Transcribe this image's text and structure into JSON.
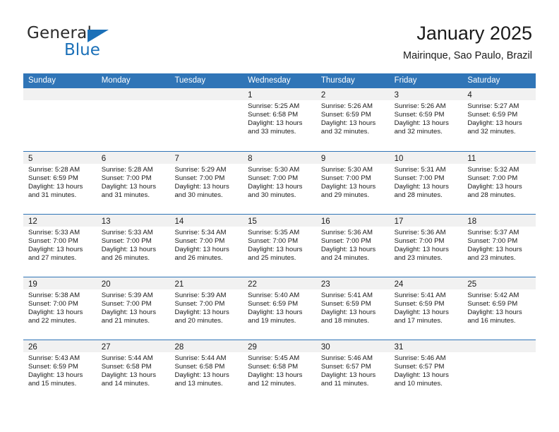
{
  "brand": {
    "name_top": "General",
    "name_bottom": "Blue",
    "accent_color": "#1b70b8"
  },
  "header": {
    "title": "January 2025",
    "subtitle": "Mairinque, Sao Paulo, Brazil",
    "header_bar_color": "#3075b7",
    "day_band_color": "#f1f1f1"
  },
  "weekdays": [
    "Sunday",
    "Monday",
    "Tuesday",
    "Wednesday",
    "Thursday",
    "Friday",
    "Saturday"
  ],
  "weeks": [
    [
      {
        "day": "",
        "sunrise": "",
        "sunset": "",
        "daylight": "",
        "empty": true
      },
      {
        "day": "",
        "sunrise": "",
        "sunset": "",
        "daylight": "",
        "empty": true
      },
      {
        "day": "",
        "sunrise": "",
        "sunset": "",
        "daylight": "",
        "empty": true
      },
      {
        "day": "1",
        "sunrise": "Sunrise: 5:25 AM",
        "sunset": "Sunset: 6:58 PM",
        "daylight": "Daylight: 13 hours and 33 minutes."
      },
      {
        "day": "2",
        "sunrise": "Sunrise: 5:26 AM",
        "sunset": "Sunset: 6:59 PM",
        "daylight": "Daylight: 13 hours and 32 minutes."
      },
      {
        "day": "3",
        "sunrise": "Sunrise: 5:26 AM",
        "sunset": "Sunset: 6:59 PM",
        "daylight": "Daylight: 13 hours and 32 minutes."
      },
      {
        "day": "4",
        "sunrise": "Sunrise: 5:27 AM",
        "sunset": "Sunset: 6:59 PM",
        "daylight": "Daylight: 13 hours and 32 minutes."
      }
    ],
    [
      {
        "day": "5",
        "sunrise": "Sunrise: 5:28 AM",
        "sunset": "Sunset: 6:59 PM",
        "daylight": "Daylight: 13 hours and 31 minutes."
      },
      {
        "day": "6",
        "sunrise": "Sunrise: 5:28 AM",
        "sunset": "Sunset: 7:00 PM",
        "daylight": "Daylight: 13 hours and 31 minutes."
      },
      {
        "day": "7",
        "sunrise": "Sunrise: 5:29 AM",
        "sunset": "Sunset: 7:00 PM",
        "daylight": "Daylight: 13 hours and 30 minutes."
      },
      {
        "day": "8",
        "sunrise": "Sunrise: 5:30 AM",
        "sunset": "Sunset: 7:00 PM",
        "daylight": "Daylight: 13 hours and 30 minutes."
      },
      {
        "day": "9",
        "sunrise": "Sunrise: 5:30 AM",
        "sunset": "Sunset: 7:00 PM",
        "daylight": "Daylight: 13 hours and 29 minutes."
      },
      {
        "day": "10",
        "sunrise": "Sunrise: 5:31 AM",
        "sunset": "Sunset: 7:00 PM",
        "daylight": "Daylight: 13 hours and 28 minutes."
      },
      {
        "day": "11",
        "sunrise": "Sunrise: 5:32 AM",
        "sunset": "Sunset: 7:00 PM",
        "daylight": "Daylight: 13 hours and 28 minutes."
      }
    ],
    [
      {
        "day": "12",
        "sunrise": "Sunrise: 5:33 AM",
        "sunset": "Sunset: 7:00 PM",
        "daylight": "Daylight: 13 hours and 27 minutes."
      },
      {
        "day": "13",
        "sunrise": "Sunrise: 5:33 AM",
        "sunset": "Sunset: 7:00 PM",
        "daylight": "Daylight: 13 hours and 26 minutes."
      },
      {
        "day": "14",
        "sunrise": "Sunrise: 5:34 AM",
        "sunset": "Sunset: 7:00 PM",
        "daylight": "Daylight: 13 hours and 26 minutes."
      },
      {
        "day": "15",
        "sunrise": "Sunrise: 5:35 AM",
        "sunset": "Sunset: 7:00 PM",
        "daylight": "Daylight: 13 hours and 25 minutes."
      },
      {
        "day": "16",
        "sunrise": "Sunrise: 5:36 AM",
        "sunset": "Sunset: 7:00 PM",
        "daylight": "Daylight: 13 hours and 24 minutes."
      },
      {
        "day": "17",
        "sunrise": "Sunrise: 5:36 AM",
        "sunset": "Sunset: 7:00 PM",
        "daylight": "Daylight: 13 hours and 23 minutes."
      },
      {
        "day": "18",
        "sunrise": "Sunrise: 5:37 AM",
        "sunset": "Sunset: 7:00 PM",
        "daylight": "Daylight: 13 hours and 23 minutes."
      }
    ],
    [
      {
        "day": "19",
        "sunrise": "Sunrise: 5:38 AM",
        "sunset": "Sunset: 7:00 PM",
        "daylight": "Daylight: 13 hours and 22 minutes."
      },
      {
        "day": "20",
        "sunrise": "Sunrise: 5:39 AM",
        "sunset": "Sunset: 7:00 PM",
        "daylight": "Daylight: 13 hours and 21 minutes."
      },
      {
        "day": "21",
        "sunrise": "Sunrise: 5:39 AM",
        "sunset": "Sunset: 7:00 PM",
        "daylight": "Daylight: 13 hours and 20 minutes."
      },
      {
        "day": "22",
        "sunrise": "Sunrise: 5:40 AM",
        "sunset": "Sunset: 6:59 PM",
        "daylight": "Daylight: 13 hours and 19 minutes."
      },
      {
        "day": "23",
        "sunrise": "Sunrise: 5:41 AM",
        "sunset": "Sunset: 6:59 PM",
        "daylight": "Daylight: 13 hours and 18 minutes."
      },
      {
        "day": "24",
        "sunrise": "Sunrise: 5:41 AM",
        "sunset": "Sunset: 6:59 PM",
        "daylight": "Daylight: 13 hours and 17 minutes."
      },
      {
        "day": "25",
        "sunrise": "Sunrise: 5:42 AM",
        "sunset": "Sunset: 6:59 PM",
        "daylight": "Daylight: 13 hours and 16 minutes."
      }
    ],
    [
      {
        "day": "26",
        "sunrise": "Sunrise: 5:43 AM",
        "sunset": "Sunset: 6:59 PM",
        "daylight": "Daylight: 13 hours and 15 minutes."
      },
      {
        "day": "27",
        "sunrise": "Sunrise: 5:44 AM",
        "sunset": "Sunset: 6:58 PM",
        "daylight": "Daylight: 13 hours and 14 minutes."
      },
      {
        "day": "28",
        "sunrise": "Sunrise: 5:44 AM",
        "sunset": "Sunset: 6:58 PM",
        "daylight": "Daylight: 13 hours and 13 minutes."
      },
      {
        "day": "29",
        "sunrise": "Sunrise: 5:45 AM",
        "sunset": "Sunset: 6:58 PM",
        "daylight": "Daylight: 13 hours and 12 minutes."
      },
      {
        "day": "30",
        "sunrise": "Sunrise: 5:46 AM",
        "sunset": "Sunset: 6:57 PM",
        "daylight": "Daylight: 13 hours and 11 minutes."
      },
      {
        "day": "31",
        "sunrise": "Sunrise: 5:46 AM",
        "sunset": "Sunset: 6:57 PM",
        "daylight": "Daylight: 13 hours and 10 minutes."
      },
      {
        "day": "",
        "sunrise": "",
        "sunset": "",
        "daylight": "",
        "empty": true
      }
    ]
  ]
}
